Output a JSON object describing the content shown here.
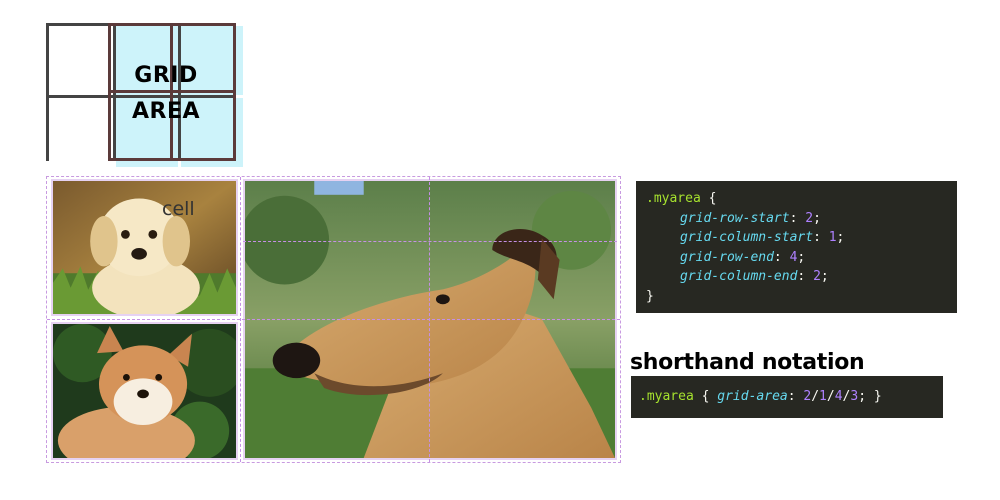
{
  "diagram": {
    "label_line1": "GRID",
    "label_line2": "AREA",
    "highlight_color": "#cdf3fa",
    "border_color": "#444444",
    "area_border_color": "#5b3a3a"
  },
  "photo_grid": {
    "cell_label": "cell",
    "dash_color": "#c58fe6"
  },
  "code_main": {
    "selector": ".myarea",
    "open_brace": "{",
    "close_brace": "}",
    "rules": [
      {
        "prop": "grid-row-start",
        "value": "2"
      },
      {
        "prop": "grid-column-start",
        "value": "1"
      },
      {
        "prop": "grid-row-end",
        "value": "4"
      },
      {
        "prop": "grid-column-end",
        "value": "2"
      }
    ]
  },
  "shorthand": {
    "heading": "shorthand notation",
    "selector": ".myarea",
    "open_brace": "{",
    "prop": "grid-area",
    "values": [
      "2",
      "1",
      "4",
      "3"
    ],
    "close_brace": "}"
  },
  "theme": {
    "code_bg": "#272822",
    "selector_color": "#a6e22e",
    "property_color": "#66d9ef",
    "number_color": "#ae81ff"
  }
}
